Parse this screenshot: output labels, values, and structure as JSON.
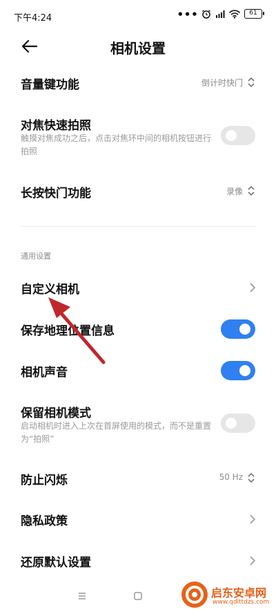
{
  "status_bar": {
    "time": "下午4:24",
    "battery": "61"
  },
  "header": {
    "title": "相机设置"
  },
  "settings": {
    "volume_key": {
      "label": "音量键功能",
      "value": "倒计时快门"
    },
    "focus_shoot": {
      "label": "对焦快速拍照",
      "description": "触摸对焦成功之后，点击对焦环中间的相机按钮进行拍照",
      "enabled": false
    },
    "long_press": {
      "label": "长按快门功能",
      "value": "录像"
    },
    "section_general": "通用设置",
    "custom_camera": {
      "label": "自定义相机"
    },
    "save_location": {
      "label": "保存地理位置信息",
      "enabled": true
    },
    "camera_sound": {
      "label": "相机声音",
      "enabled": true
    },
    "keep_mode": {
      "label": "保留相机模式",
      "description": "启动相机时进入上次在首屏使用的模式，而不是重置为“拍照”",
      "enabled": false
    },
    "anti_flicker": {
      "label": "防止闪烁",
      "value": "50 Hz"
    },
    "privacy": {
      "label": "隐私政策"
    },
    "restore": {
      "label": "还原默认设置"
    }
  },
  "watermark": {
    "name": "启东安卓网",
    "url": "www.qdlttdzs.com"
  },
  "colors": {
    "accent": "#2f80f0",
    "annotation_arrow": "#c0272d",
    "watermark": "#e8611a"
  }
}
